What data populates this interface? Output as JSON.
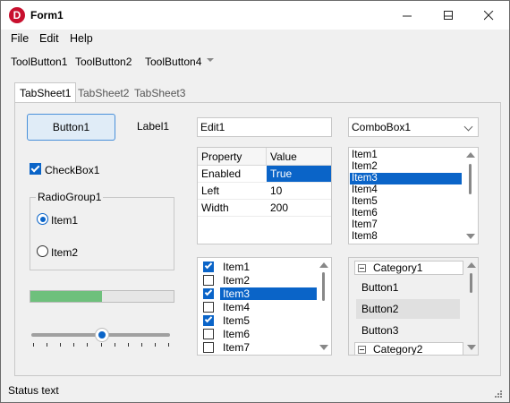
{
  "window": {
    "title": "Form1",
    "app_icon_letter": "D"
  },
  "menu": {
    "items": [
      "File",
      "Edit",
      "Help"
    ]
  },
  "toolbar": {
    "buttons": [
      "ToolButton1",
      "ToolButton2",
      "ToolButton4"
    ]
  },
  "tabs": [
    {
      "label": "TabSheet1",
      "active": true
    },
    {
      "label": "TabSheet2",
      "active": false
    },
    {
      "label": "TabSheet3",
      "active": false
    }
  ],
  "controls": {
    "button1": "Button1",
    "label1": "Label1",
    "edit1": "Edit1",
    "combobox1": "ComboBox1",
    "checkbox1": {
      "label": "CheckBox1",
      "checked": true
    },
    "radiogroup": {
      "caption": "RadioGroup1",
      "items": [
        {
          "label": "Item1",
          "checked": true
        },
        {
          "label": "Item2",
          "checked": false
        }
      ]
    },
    "progress_percent": 50,
    "slider": {
      "position": 5,
      "ticks": 11
    }
  },
  "grid": {
    "headers": [
      "Property",
      "Value"
    ],
    "rows": [
      {
        "property": "Enabled",
        "value": "True",
        "selected": true
      },
      {
        "property": "Left",
        "value": "10",
        "selected": false
      },
      {
        "property": "Width",
        "value": "200",
        "selected": false
      }
    ]
  },
  "listbox": {
    "items": [
      "Item1",
      "Item2",
      "Item3",
      "Item4",
      "Item5",
      "Item6",
      "Item7",
      "Item8"
    ],
    "selected_index": 2
  },
  "checklist": {
    "items": [
      {
        "label": "Item1",
        "checked": true,
        "selected": false
      },
      {
        "label": "Item2",
        "checked": false,
        "selected": false
      },
      {
        "label": "Item3",
        "checked": true,
        "selected": true
      },
      {
        "label": "Item4",
        "checked": false,
        "selected": false
      },
      {
        "label": "Item5",
        "checked": true,
        "selected": false
      },
      {
        "label": "Item6",
        "checked": false,
        "selected": false
      },
      {
        "label": "Item7",
        "checked": false,
        "selected": false
      }
    ]
  },
  "categories": {
    "category1": "Category1",
    "category1_buttons": [
      "Button1",
      "Button2",
      "Button3"
    ],
    "category2": "Category2"
  },
  "status": {
    "text": "Status text"
  },
  "colors": {
    "accent": "#0a64c8",
    "progress": "#6ec07c",
    "icon_red": "#c8102e"
  }
}
